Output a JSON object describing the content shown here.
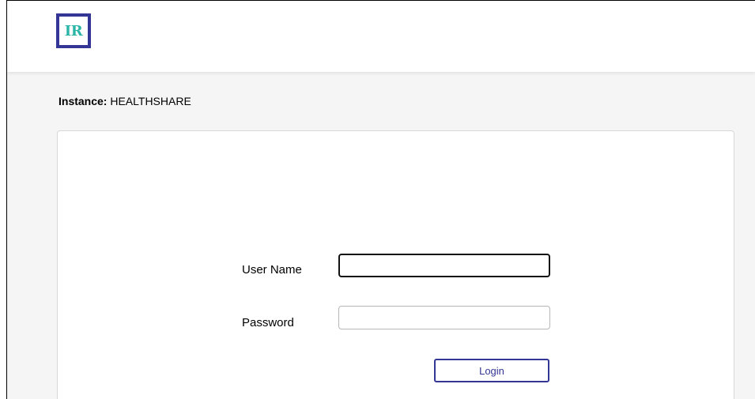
{
  "header": {
    "logo_text": "IR"
  },
  "instance": {
    "label": "Instance:",
    "value": "HEALTHSHARE"
  },
  "login_form": {
    "username_label": "User Name",
    "username_value": "",
    "password_label": "Password",
    "password_value": "",
    "login_button": "Login"
  },
  "colors": {
    "brand_primary": "#333695",
    "brand_accent": "#2bb5a7",
    "page_background": "#f5f5f5"
  }
}
